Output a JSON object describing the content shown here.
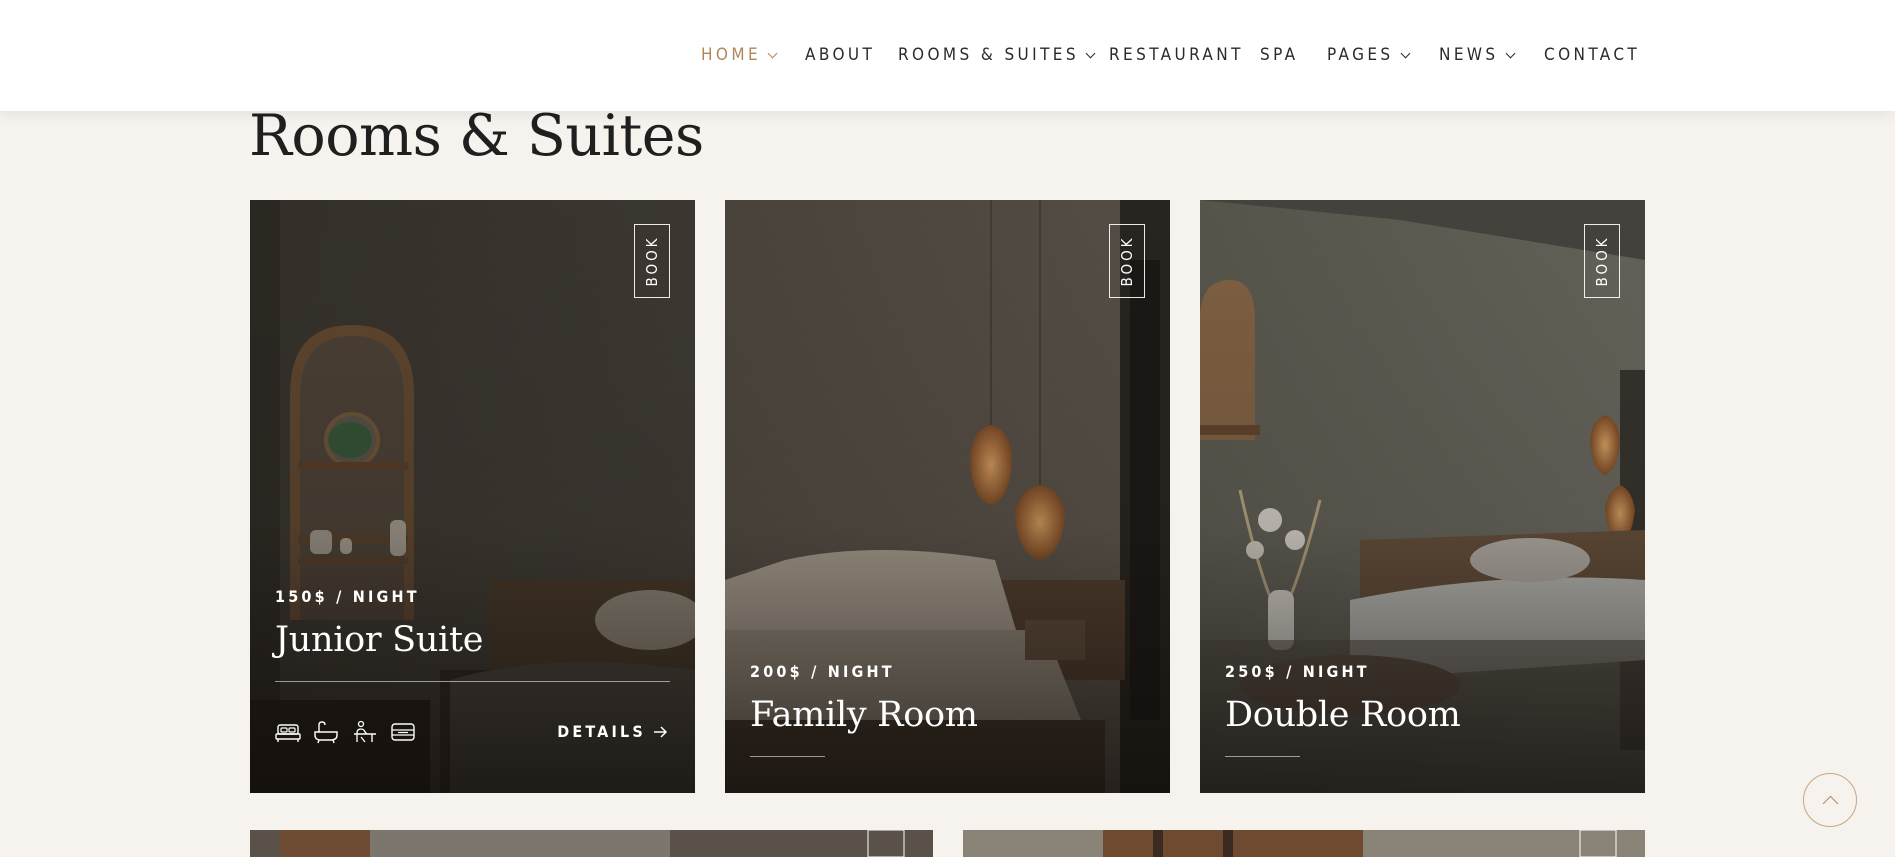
{
  "nav": {
    "items": [
      {
        "label": "HOME",
        "has_dropdown": true,
        "active": true
      },
      {
        "label": "ABOUT",
        "has_dropdown": false,
        "active": false
      },
      {
        "label": "ROOMS & SUITES",
        "has_dropdown": true,
        "active": false
      },
      {
        "label": "RESTAURANT",
        "has_dropdown": false,
        "active": false
      },
      {
        "label": "SPA",
        "has_dropdown": false,
        "active": false
      },
      {
        "label": "PAGES",
        "has_dropdown": true,
        "active": false
      },
      {
        "label": "NEWS",
        "has_dropdown": true,
        "active": false
      },
      {
        "label": "CONTACT",
        "has_dropdown": false,
        "active": false
      }
    ]
  },
  "section": {
    "title": "Rooms & Suites"
  },
  "rooms": [
    {
      "price": "150$ / NIGHT",
      "name": "Junior Suite",
      "book_label": "BOOK",
      "details_label": "DETAILS",
      "amenities": [
        "bed-icon",
        "bathtub-icon",
        "desk-icon",
        "wardrobe-icon"
      ]
    },
    {
      "price": "200$ / NIGHT",
      "name": "Family Room",
      "book_label": "BOOK"
    },
    {
      "price": "250$ / NIGHT",
      "name": "Double Room",
      "book_label": "BOOK"
    }
  ],
  "colors": {
    "accent": "#b0875b",
    "background": "#f6f3ee",
    "header": "#ffffff",
    "text": "#2a2a2a"
  }
}
